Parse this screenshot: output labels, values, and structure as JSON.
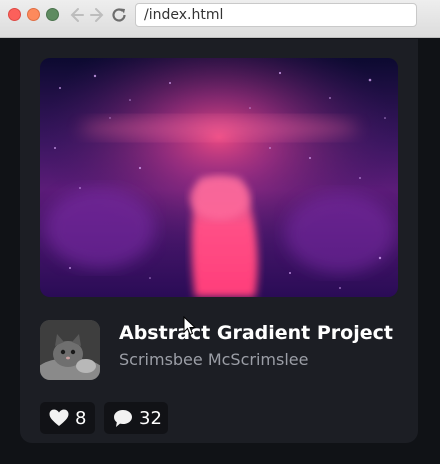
{
  "browser": {
    "url": "/index.html"
  },
  "card": {
    "title": "Abstract Gradient Project",
    "author": "Scrimsbee McScrimslee",
    "hero_icon": "abstract-gradient-image",
    "avatar_icon": "kitten-avatar",
    "stats": {
      "likes": "8",
      "likes_icon": "heart-icon",
      "comments": "32",
      "comments_icon": "speech-bubble-icon"
    }
  },
  "colors": {
    "page_background": "#101216",
    "card_background": "#1c1e24",
    "stat_background": "#111216",
    "title": "#ffffff",
    "author": "#9b9ea6",
    "hero_accent": "#ff4f86",
    "hero_dark": "#1a0b3a"
  }
}
